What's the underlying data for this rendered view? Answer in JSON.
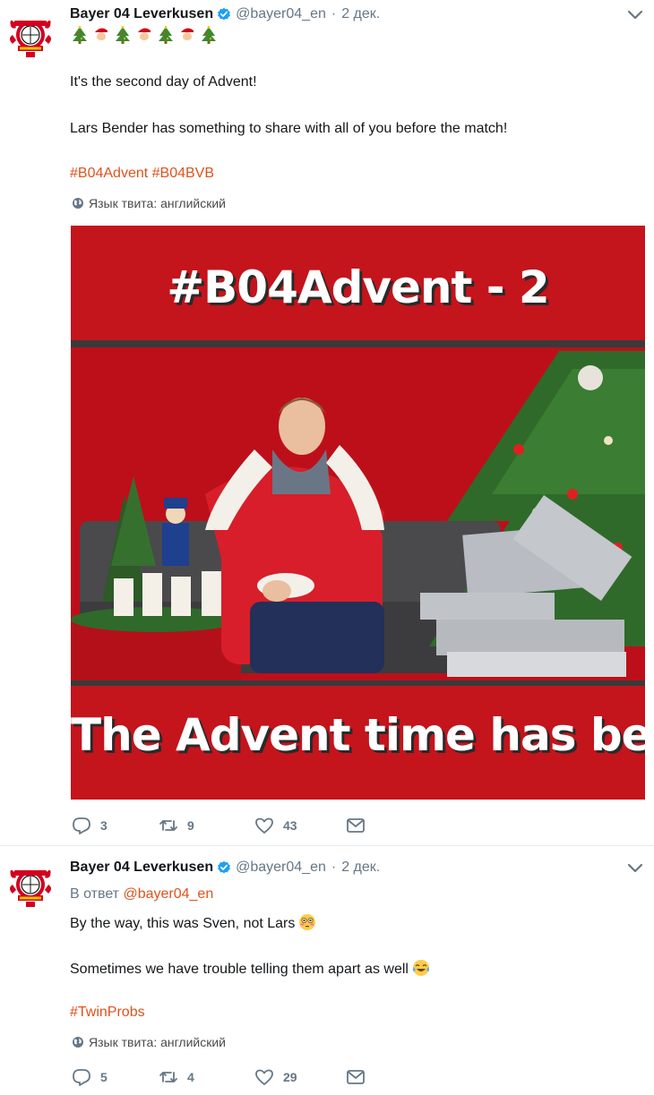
{
  "tweets": [
    {
      "author_name": "Bayer 04 Leverkusen",
      "handle": "@bayer04_en",
      "separator": "·",
      "time": "2 дек.",
      "emoji_line": [
        "christmas-tree",
        "santa",
        "christmas-tree",
        "santa",
        "christmas-tree",
        "santa",
        "christmas-tree"
      ],
      "text_1": "It's the second day of Advent!",
      "text_2": "Lars Bender has something to share with all of you before the match!",
      "hashtag_1": "#B04Advent",
      "hashtag_2": "#B04BVB",
      "lang_note": "Язык твита: английский",
      "media": {
        "title": "#B04Advent - 2",
        "caption": "The Advent time has begun."
      },
      "actions": {
        "replies": "3",
        "retweets": "9",
        "likes": "43"
      }
    },
    {
      "author_name": "Bayer 04 Leverkusen",
      "handle": "@bayer04_en",
      "separator": "·",
      "time": "2 дек.",
      "reply_prefix": "В ответ",
      "reply_to": "@bayer04_en",
      "text_1": "By the way, this was Sven, not Lars",
      "text_1_emoji": "flushed-face",
      "text_2": "Sometimes we have trouble telling them apart as well",
      "text_2_emoji": "tears-of-joy-face",
      "hashtag_1": "#TwinProbs",
      "lang_note": "Язык твита: английский",
      "actions": {
        "replies": "5",
        "retweets": "4",
        "likes": "29"
      }
    }
  ],
  "colors": {
    "link": "#e0521d",
    "muted": "#657786",
    "verified": "#1da1f2",
    "media_red": "#b8121a"
  }
}
